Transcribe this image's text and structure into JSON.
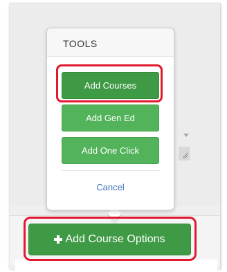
{
  "tools_popover": {
    "title": "TOOLS",
    "buttons": [
      {
        "label": "Add Courses"
      },
      {
        "label": "Add Gen Ed"
      },
      {
        "label": "Add One Click"
      }
    ],
    "cancel_label": "Cancel"
  },
  "main_action": {
    "label": "Add Course Options",
    "icon": "plus-icon"
  },
  "colors": {
    "primary_green": "#52b35a",
    "active_green": "#3f9a45",
    "link_blue": "#3f74b8",
    "highlight_red": "#e0192e"
  }
}
